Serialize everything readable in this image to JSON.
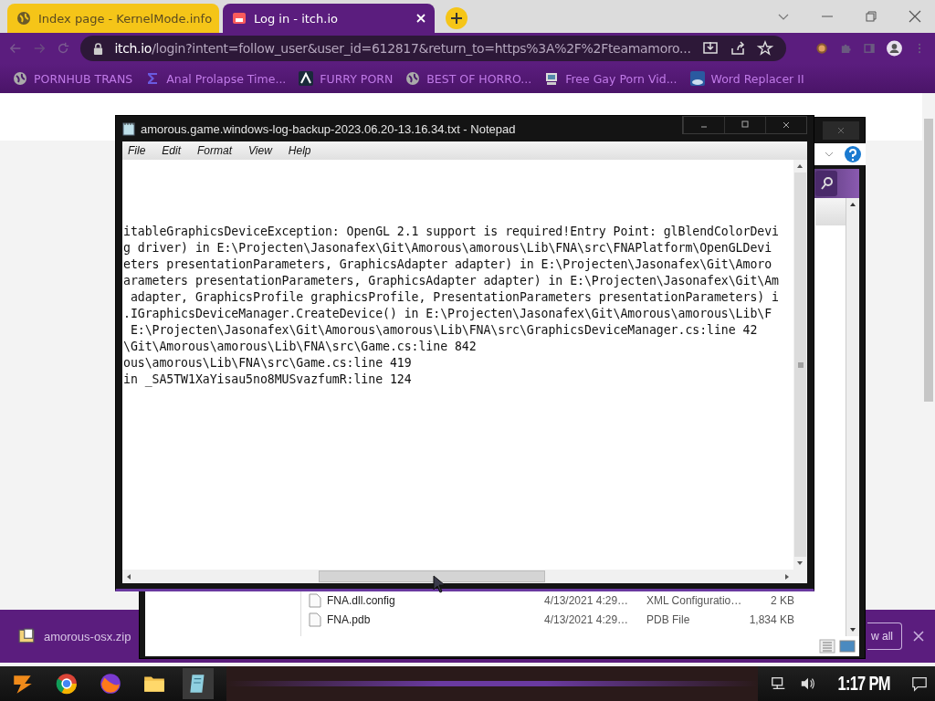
{
  "browser": {
    "tabs": [
      {
        "title": "Index page - KernelMode.info",
        "selected": false
      },
      {
        "title": "Log in - itch.io",
        "selected": true
      }
    ],
    "url": {
      "host": "itch.io",
      "path": "/login?intent=follow_user&user_id=612817&return_to=https%3A%2F%2Fteamamoro..."
    },
    "bookmarks": [
      {
        "label": "PORNHUB TRANS"
      },
      {
        "label": "Anal Prolapse Time..."
      },
      {
        "label": "FURRY PORN"
      },
      {
        "label": "BEST OF HORRO..."
      },
      {
        "label": "Free Gay Porn Vid..."
      },
      {
        "label": "Word Replacer II"
      }
    ]
  },
  "downloads": {
    "file": "amorous-osx.zip",
    "button": "w all"
  },
  "explorer": {
    "rows": [
      {
        "name": "FNA.dll.config",
        "date": "4/13/2021 4:29…",
        "type": "XML Configuratio…",
        "size": "2 KB"
      },
      {
        "name": "FNA.pdb",
        "date": "4/13/2021 4:29…",
        "type": "PDB File",
        "size": "1,834 KB"
      }
    ]
  },
  "notepad": {
    "title": "amorous.game.windows-log-backup-2023.06.20-13.16.34.txt - Notepad",
    "menu": [
      "File",
      "Edit",
      "Format",
      "View",
      "Help"
    ],
    "lines": [
      "itableGraphicsDeviceException: OpenGL 2.1 support is required!Entry Point: glBlendColorDevi",
      "g driver) in E:\\Projecten\\Jasonafex\\Git\\Amorous\\amorous\\Lib\\FNA\\src\\FNAPlatform\\OpenGLDevi",
      "eters presentationParameters, GraphicsAdapter adapter) in E:\\Projecten\\Jasonafex\\Git\\Amoro",
      "arameters presentationParameters, GraphicsAdapter adapter) in E:\\Projecten\\Jasonafex\\Git\\Am",
      " adapter, GraphicsProfile graphicsProfile, PresentationParameters presentationParameters) i",
      ".IGraphicsDeviceManager.CreateDevice() in E:\\Projecten\\Jasonafex\\Git\\Amorous\\amorous\\Lib\\F",
      " E:\\Projecten\\Jasonafex\\Git\\Amorous\\amorous\\Lib\\FNA\\src\\GraphicsDeviceManager.cs:line 42",
      "\\Git\\Amorous\\amorous\\Lib\\FNA\\src\\Game.cs:line 842",
      "ous\\amorous\\Lib\\FNA\\src\\Game.cs:line 419",
      "in _SA5TW1XaYisau5no8MUSvazfumR:line 124"
    ]
  },
  "taskbar": {
    "clock": "1:17 PM"
  }
}
